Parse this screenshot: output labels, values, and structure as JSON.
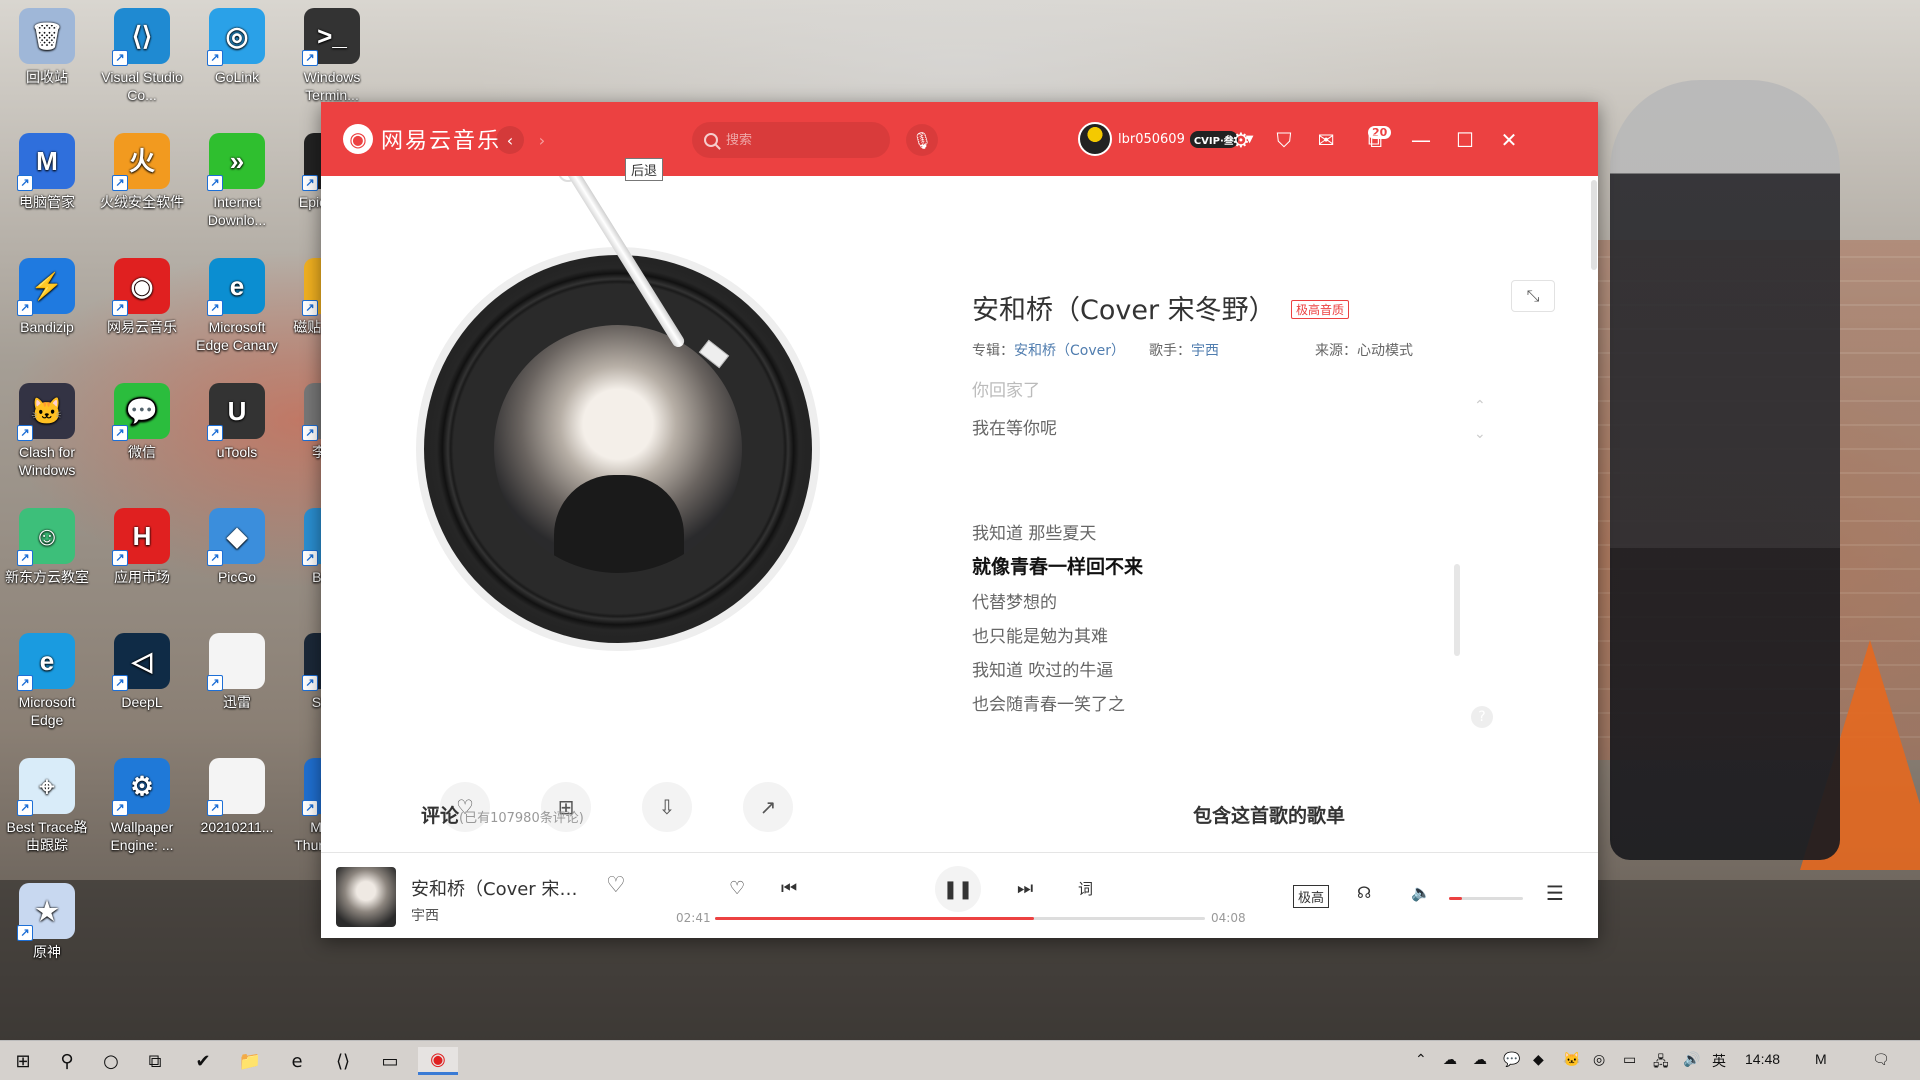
{
  "desktop": {
    "icons": [
      {
        "label": "回收站",
        "glyph": "🗑",
        "color": "#9fb7d8"
      },
      {
        "label": "Visual Studio Co...",
        "glyph": "⟨⟩",
        "color": "#1f8ad2"
      },
      {
        "label": "GoLink",
        "glyph": "◎",
        "color": "#2aa1e8"
      },
      {
        "label": "Windows Termin...",
        "glyph": ">_",
        "color": "#333"
      },
      {
        "label": "电脑管家",
        "glyph": "M",
        "color": "#2f6fdc"
      },
      {
        "label": "火绒安全软件",
        "glyph": "火",
        "color": "#f29a1f"
      },
      {
        "label": "Internet Downlo...",
        "glyph": "»",
        "color": "#2fbf2f"
      },
      {
        "label": "Epic Lau...",
        "glyph": "E",
        "color": "#222"
      },
      {
        "label": "Bandizip",
        "glyph": "⚡",
        "color": "#1f7ae0"
      },
      {
        "label": "网易云音乐",
        "glyph": "◉",
        "color": "#e02020"
      },
      {
        "label": "Microsoft Edge Canary",
        "glyph": "e",
        "color": "#0b8ed1"
      },
      {
        "label": "磁贴工具 v...",
        "glyph": "◐",
        "color": "#f0b020"
      },
      {
        "label": "Clash for Windows",
        "glyph": "🐱",
        "color": "#334"
      },
      {
        "label": "微信",
        "glyph": "💬",
        "color": "#2bbd3d"
      },
      {
        "label": "uTools",
        "glyph": "U",
        "color": "#333"
      },
      {
        "label": "李梗...",
        "glyph": "",
        "color": "#777"
      },
      {
        "label": "新东方云教室",
        "glyph": "☺",
        "color": "#3dbf7a"
      },
      {
        "label": "应用市场",
        "glyph": "H",
        "color": "#e02020"
      },
      {
        "label": "PicGo",
        "glyph": "◆",
        "color": "#3b8edc"
      },
      {
        "label": "Best...",
        "glyph": "",
        "color": "#2a8ed0"
      },
      {
        "label": "Microsoft Edge",
        "glyph": "e",
        "color": "#1a9be0"
      },
      {
        "label": "DeepL",
        "glyph": "◁",
        "color": "#0f2b46"
      },
      {
        "label": "迅雷",
        "glyph": "",
        "color": "#f4f4f4"
      },
      {
        "label": "Steam",
        "glyph": "S",
        "color": "#1b2838"
      },
      {
        "label": "Best Trace路由跟踪",
        "glyph": "⌖",
        "color": "#d9ecf9"
      },
      {
        "label": "Wallpaper Engine: ...",
        "glyph": "⚙",
        "color": "#1f79d8"
      },
      {
        "label": "20210211...",
        "glyph": "",
        "color": "#f4f4f4"
      },
      {
        "label": "Mozilla Thunderbird",
        "glyph": "✉",
        "color": "#1f6fd0"
      },
      {
        "label": "原神",
        "glyph": "★",
        "color": "#c8d8f0"
      }
    ]
  },
  "app": {
    "name": "网易云音乐",
    "tooltip": "后退",
    "search_placeholder": "搜索",
    "username": "lbr050609",
    "vip_label": "CVIP·叁",
    "mail_count": "20"
  },
  "song": {
    "title": "安和桥（Cover 宋冬野）",
    "quality_tag": "极高音质",
    "album_label": "专辑：",
    "album": "安和桥（Cover）",
    "artist_label": "歌手：",
    "artist": "宇西",
    "source_label": "来源：",
    "source": "心动模式"
  },
  "lyrics": [
    {
      "text": "你回家了",
      "state": "faded"
    },
    {
      "text": "我在等你呢",
      "state": "normal"
    },
    {
      "text": "我知道 那些夏天",
      "state": "normal"
    },
    {
      "text": "就像青春一样回不来",
      "state": "active"
    },
    {
      "text": "代替梦想的",
      "state": "normal"
    },
    {
      "text": "也只能是勉为其难",
      "state": "normal"
    },
    {
      "text": "我知道 吹过的牛逼",
      "state": "normal"
    },
    {
      "text": "也会随青春一笑了之",
      "state": "normal"
    }
  ],
  "sections": {
    "comments_title": "评论",
    "comments_count": "(已有107980条评论)",
    "playlists_title": "包含这首歌的歌单"
  },
  "player": {
    "title": "安和桥（Cover 宋冬野）",
    "artist": "宇西",
    "current_time": "02:41",
    "total_time": "04:08",
    "progress": 0.65,
    "lyrics_btn": "词",
    "quality_btn": "极高",
    "volume": 0.18
  },
  "taskbar": {
    "time": "14:48",
    "ime": "英"
  }
}
